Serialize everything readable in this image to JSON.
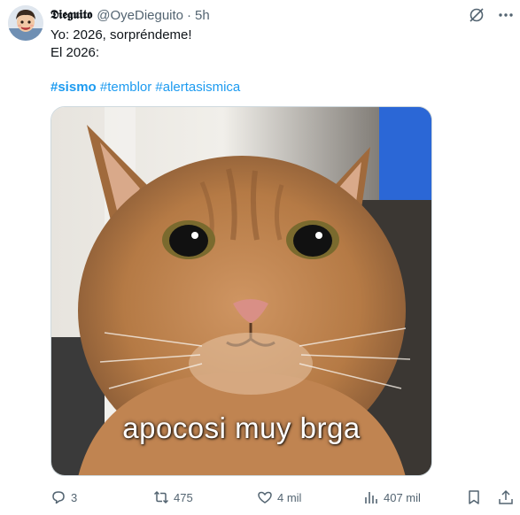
{
  "author": {
    "display_name": "𝕯𝖎𝖊𝖌𝖚𝖎𝖙𝖔",
    "handle": "@OyeDieguito",
    "separator": "·",
    "time": "5h"
  },
  "tweet": {
    "lines": [
      "Yo: 2026, sorpréndeme!",
      "El 2026:"
    ],
    "hashtags": [
      {
        "text": "#sismo"
      },
      {
        "text": "#temblor"
      },
      {
        "text": "#alertasismica"
      }
    ]
  },
  "media": {
    "caption": "apocosi muy brga",
    "alt_subject": "orange-cat-photo"
  },
  "actions": {
    "replies": "3",
    "retweets": "475",
    "likes": "4 mil",
    "views": "407 mil"
  },
  "colors": {
    "accent": "#1d9bf0",
    "text": "#0f1419",
    "secondary": "#536471"
  },
  "icons": [
    "grok-icon",
    "more-icon",
    "reply-icon",
    "retweet-icon",
    "like-icon",
    "views-icon",
    "bookmark-icon",
    "share-icon"
  ]
}
